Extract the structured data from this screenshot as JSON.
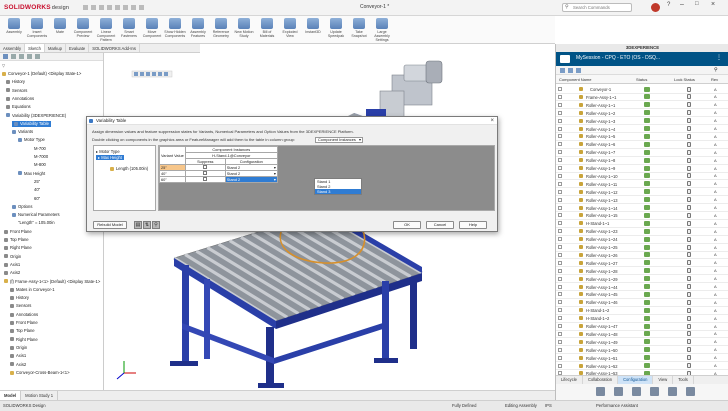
{
  "app": {
    "logo_brand": "SOLIDWORKS",
    "logo_suffix": "design",
    "doc_title": "Conveyor-1 *",
    "search_placeholder": "Search Commands"
  },
  "ribbon": {
    "buttons": [
      "Assembly",
      "Insert Components",
      "Mate",
      "Component Preview",
      "Linear Component Pattern",
      "Smart Fasteners",
      "Move Component",
      "Show Hidden Components",
      "Assembly Features",
      "Reference Geometry",
      "New Motion Study",
      "Bill of Materials",
      "Exploded View",
      "Instant3D",
      "Update Speedpak",
      "Take Snapshot",
      "Large Assembly Settings"
    ]
  },
  "command_tabs": [
    "Assembly",
    "Sketch",
    "Markup",
    "Evaluate",
    "SOLIDWORKS Add-Ins"
  ],
  "feature_tree": {
    "rows": [
      {
        "label": "Conveyor-1 (Default) <Display State-1>",
        "icon": "y"
      },
      {
        "label": "History",
        "icon": "g"
      },
      {
        "label": "Sensors",
        "icon": "g"
      },
      {
        "label": "Annotations",
        "icon": "g"
      },
      {
        "label": "Equations",
        "icon": "g"
      },
      {
        "label": "Variability (3DEXPERIENCE)",
        "icon": "b"
      },
      {
        "label": "Variability Table",
        "icon": "b",
        "selected": true
      },
      {
        "label": "Variants",
        "icon": "b"
      },
      {
        "label": "Motor Type",
        "icon": "b"
      },
      {
        "label": "M-700",
        "icon": ""
      },
      {
        "label": "M-7000",
        "icon": ""
      },
      {
        "label": "M-800",
        "icon": ""
      },
      {
        "label": "Max Height",
        "icon": "b"
      },
      {
        "label": "25\"",
        "icon": ""
      },
      {
        "label": "40\"",
        "icon": ""
      },
      {
        "label": "60\"",
        "icon": ""
      },
      {
        "label": "Options",
        "icon": "b"
      },
      {
        "label": "Numerical Parameters",
        "icon": "b"
      },
      {
        "label": "\"Length\" = 105.00in",
        "icon": ""
      },
      {
        "label": "Front Plane",
        "icon": "g"
      },
      {
        "label": "Top Plane",
        "icon": "g"
      },
      {
        "label": "Right Plane",
        "icon": "g"
      },
      {
        "label": "Origin",
        "icon": "g"
      },
      {
        "label": "Axis1",
        "icon": "g"
      },
      {
        "label": "Axis2",
        "icon": "g"
      },
      {
        "label": "(f) Frame-Assy-1<1> (Default) <Display State-1>",
        "icon": "y"
      },
      {
        "label": "Mates in Conveyor-1",
        "icon": "g"
      },
      {
        "label": "History",
        "icon": "g"
      },
      {
        "label": "Sensors",
        "icon": "g"
      },
      {
        "label": "Annotations",
        "icon": "g"
      },
      {
        "label": "Front Plane",
        "icon": "g"
      },
      {
        "label": "Top Plane",
        "icon": "g"
      },
      {
        "label": "Right Plane",
        "icon": "g"
      },
      {
        "label": "Origin",
        "icon": "g"
      },
      {
        "label": "Axis1",
        "icon": "g"
      },
      {
        "label": "Axis2",
        "icon": "g"
      },
      {
        "label": "Conveyor-Cross-Beam-1<1>",
        "icon": "y"
      }
    ]
  },
  "dialog": {
    "title": "Variability Table",
    "instruction_1": "Assign dimension values and feature suppression states for Variants, Numerical Parameters and Option Values from the 3DEXPERIENCE Platform.",
    "instruction_2": "Double clicking on components in the graphics area or FeatureManager will add them to the table in column group:",
    "column_group_value": "Component Instances",
    "variants": [
      {
        "label": "Motor Type",
        "selected": false
      },
      {
        "label": "Max Height",
        "selected": true
      }
    ],
    "numerical_label": "Length (105.00in)",
    "table": {
      "group_header": "Component Instances",
      "component": "H-Stand-1@Conveyor",
      "col_suppress": "Suppress",
      "col_config": "Configuration",
      "var_col": "Variant Value",
      "rows": [
        {
          "value": "25\"",
          "config": "Stand 2"
        },
        {
          "value": "40\"",
          "config": "Stand 2"
        },
        {
          "value": "60\"",
          "config": "Stand 2"
        }
      ]
    },
    "dropdown": {
      "items": [
        "Stand 1",
        "Stand 2",
        "Stand 3"
      ],
      "selected_index": 2
    },
    "rebuild_label": "Rebuild Model",
    "ok_label": "OK",
    "cancel_label": "Cancel",
    "help_label": "Help"
  },
  "right_panel": {
    "header": "3DEXPERIENCE",
    "session_label": "MySession - CPQ - ETO (OS - DSQ...",
    "columns": {
      "name": "Component Name",
      "status": "Status",
      "lock": "Lock Status",
      "rev": "Rev"
    },
    "rows": [
      "Conveyor-1",
      "Frame-Assy-1~1",
      "Roller-Assy-1~1",
      "Roller-Assy-1~2",
      "Roller-Assy-1~3",
      "Roller-Assy-1~4",
      "Roller-Assy-1~5",
      "Roller-Assy-1~6",
      "Roller-Assy-1~7",
      "Roller-Assy-1~8",
      "Roller-Assy-1~9",
      "Roller-Assy-1~10",
      "Roller-Assy-1~11",
      "Roller-Assy-1~12",
      "Roller-Assy-1~13",
      "Roller-Assy-1~14",
      "Roller-Assy-1~15",
      "H-Stand-1~1",
      "Roller-Assy-1~23",
      "Roller-Assy-1~24",
      "Roller-Assy-1~25",
      "Roller-Assy-1~26",
      "Roller-Assy-1~27",
      "Roller-Assy-1~28",
      "Roller-Assy-1~29",
      "Roller-Assy-1~44",
      "Roller-Assy-1~45",
      "Roller-Assy-1~46",
      "H-Stand-1~2",
      "H-Stand-1~2",
      "Roller-Assy-1~47",
      "Roller-Assy-1~48",
      "Roller-Assy-1~49",
      "Roller-Assy-1~50",
      "Roller-Assy-1~51",
      "Roller-Assy-1~52",
      "Roller-Assy-1~53"
    ],
    "revision": "A",
    "tabs": [
      "Lifecycle",
      "Collaboration",
      "Configuration",
      "View",
      "Tools"
    ],
    "active_tab": "Configuration"
  },
  "bottom_tabs": [
    "Model",
    "Motion Study 1"
  ],
  "status": {
    "left": "SOLIDWORKS Design",
    "defined": "Fully Defined",
    "mode": "Editing Assembly",
    "units": "IPS",
    "assistant": "Performance Assistant"
  },
  "colors": {
    "ds_blue": "#005386",
    "frame_blue": "#2a3fa8",
    "selection_blue": "#2f7cd3"
  }
}
